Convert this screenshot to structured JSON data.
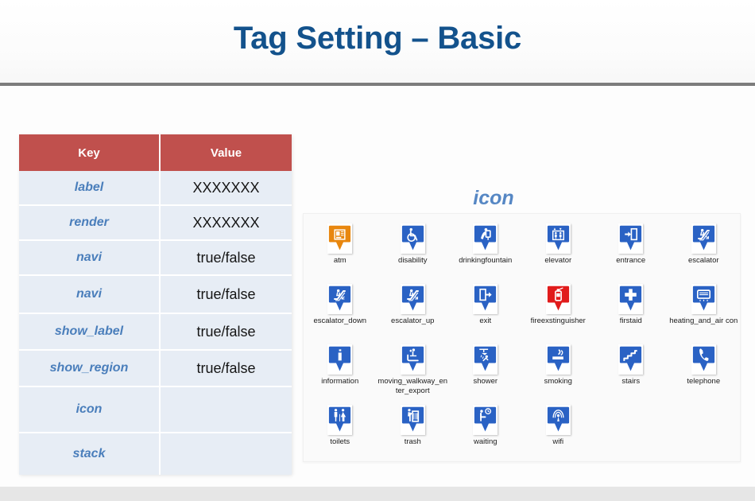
{
  "slide": {
    "title": "Tag Setting – Basic",
    "title_color": "#13528c",
    "divider_color": "#7c7c7c"
  },
  "table": {
    "header_bg": "#c0504d",
    "row_bg": "#e7edf5",
    "key_color": "#4a7ebb",
    "columns": [
      "Key",
      "Value"
    ],
    "rows": [
      {
        "key": "label",
        "value": "XXXXXXX"
      },
      {
        "key": "render",
        "value": "XXXXXXX"
      },
      {
        "key": "navi",
        "value": "true/false"
      },
      {
        "key": "navi",
        "value": "true/false"
      },
      {
        "key": "show_label",
        "value": "true/false"
      },
      {
        "key": "show_region",
        "value": "true/false"
      },
      {
        "key": "icon",
        "value": ""
      },
      {
        "key": "stack",
        "value": ""
      }
    ]
  },
  "icon_panel": {
    "heading": "icon",
    "heading_color": "#5687c4",
    "panel_bg": "#fafafa",
    "pin_blue": "#2a62c4",
    "pin_orange": "#e8870f",
    "pin_red": "#e11b1b",
    "icons": [
      {
        "name": "atm",
        "label": "atm",
        "color": "#e8870f",
        "glyph": "atm-icon"
      },
      {
        "name": "disability",
        "label": "disability",
        "color": "#2a62c4",
        "glyph": "wheelchair-icon"
      },
      {
        "name": "drinkingfountain",
        "label": "drinkingfountain",
        "color": "#2a62c4",
        "glyph": "drinking-fountain-icon"
      },
      {
        "name": "elevator",
        "label": "elevator",
        "color": "#2a62c4",
        "glyph": "elevator-icon"
      },
      {
        "name": "entrance",
        "label": "entrance",
        "color": "#2a62c4",
        "glyph": "entrance-icon"
      },
      {
        "name": "escalator",
        "label": "escalator",
        "color": "#2a62c4",
        "glyph": "escalator-icon"
      },
      {
        "name": "escalator_down",
        "label": "escalator_down",
        "color": "#2a62c4",
        "glyph": "escalator-down-icon"
      },
      {
        "name": "escalator_up",
        "label": "escalator_up",
        "color": "#2a62c4",
        "glyph": "escalator-up-icon"
      },
      {
        "name": "exit",
        "label": "exit",
        "color": "#2a62c4",
        "glyph": "exit-icon"
      },
      {
        "name": "fireexstinguisher",
        "label": "fireexstinguisher",
        "color": "#e11b1b",
        "glyph": "fire-extinguisher-icon"
      },
      {
        "name": "firstaid",
        "label": "firstaid",
        "color": "#2a62c4",
        "glyph": "first-aid-icon"
      },
      {
        "name": "heating_and_aircon",
        "label": "heating_and_air con",
        "color": "#2a62c4",
        "glyph": "hvac-icon"
      },
      {
        "name": "information",
        "label": "information",
        "color": "#2a62c4",
        "glyph": "information-icon"
      },
      {
        "name": "moving_walkway_enter_export",
        "label": "moving_walkway_enter_export",
        "color": "#2a62c4",
        "glyph": "moving-walkway-icon"
      },
      {
        "name": "shower",
        "label": "shower",
        "color": "#2a62c4",
        "glyph": "shower-icon"
      },
      {
        "name": "smoking",
        "label": "smoking",
        "color": "#2a62c4",
        "glyph": "smoking-icon"
      },
      {
        "name": "stairs",
        "label": "stairs",
        "color": "#2a62c4",
        "glyph": "stairs-icon"
      },
      {
        "name": "telephone",
        "label": "telephone",
        "color": "#2a62c4",
        "glyph": "telephone-icon"
      },
      {
        "name": "toilets",
        "label": "toilets",
        "color": "#2a62c4",
        "glyph": "toilets-icon"
      },
      {
        "name": "trash",
        "label": "trash",
        "color": "#2a62c4",
        "glyph": "trash-icon"
      },
      {
        "name": "waiting",
        "label": "waiting",
        "color": "#2a62c4",
        "glyph": "waiting-icon"
      },
      {
        "name": "wifi",
        "label": "wifi",
        "color": "#2a62c4",
        "glyph": "wifi-icon"
      }
    ]
  }
}
